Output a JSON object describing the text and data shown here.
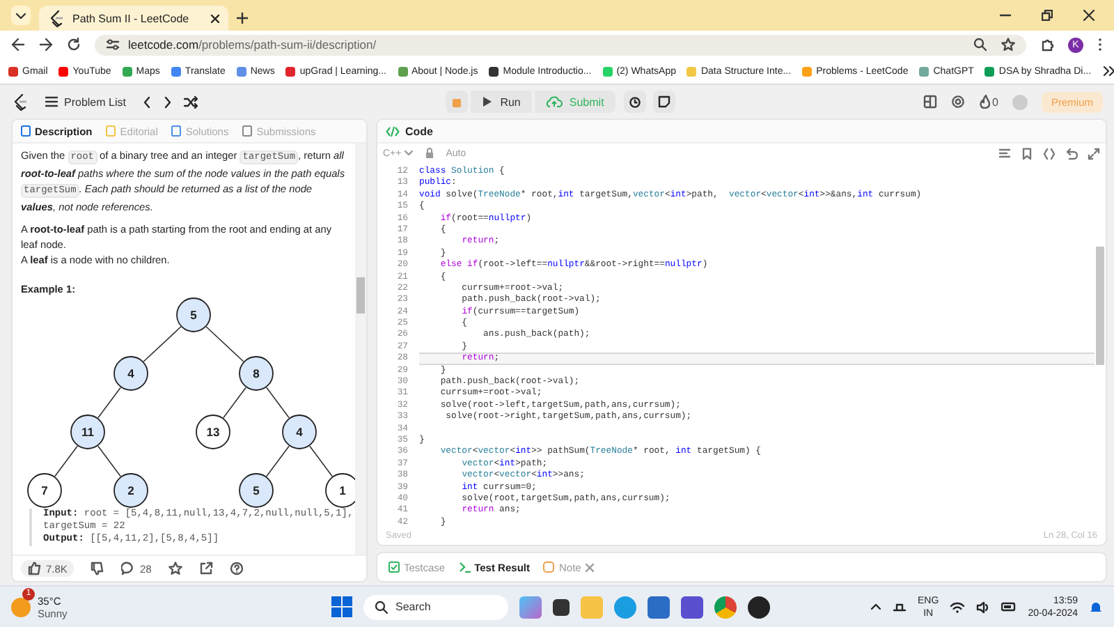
{
  "browser": {
    "tab_title": "Path Sum II - LeetCode",
    "url": {
      "host": "leetcode.com",
      "path": "/problems/path-sum-ii/description/"
    },
    "profile_initial": "K",
    "bookmarks": [
      {
        "label": "Gmail",
        "color": "#d93025"
      },
      {
        "label": "YouTube",
        "color": "#ff0000"
      },
      {
        "label": "Maps",
        "color": "#34a853"
      },
      {
        "label": "Translate",
        "color": "#4285f4"
      },
      {
        "label": "News",
        "color": "#5f8fe8"
      },
      {
        "label": "upGrad | Learning...",
        "color": "#e1262d"
      },
      {
        "label": "About | Node.js",
        "color": "#5fa04e"
      },
      {
        "label": "Module Introductio...",
        "color": "#333333"
      },
      {
        "label": "(2) WhatsApp",
        "color": "#25d366"
      },
      {
        "label": "Data Structure Inte...",
        "color": "#f2c744"
      },
      {
        "label": "Problems - LeetCode",
        "color": "#ffa116"
      },
      {
        "label": "ChatGPT",
        "color": "#74aa9c"
      },
      {
        "label": "DSA by Shradha Di...",
        "color": "#0f9d58"
      }
    ]
  },
  "leetcode_nav": {
    "problem_list": "Problem List",
    "run": "Run",
    "submit": "Submit",
    "streak": "0",
    "premium": "Premium"
  },
  "problem": {
    "tabs": [
      {
        "label": "Description",
        "selected": true
      },
      {
        "label": "Editorial",
        "selected": false
      },
      {
        "label": "Solutions",
        "selected": false
      },
      {
        "label": "Submissions",
        "selected": false
      }
    ],
    "paragraphs": [
      [
        {
          "kind": "text",
          "text": "Given the "
        },
        {
          "kind": "code",
          "text": "root"
        },
        {
          "kind": "text",
          "text": " of a binary tree and an integer "
        },
        {
          "kind": "code",
          "text": "targetSum"
        },
        {
          "kind": "text",
          "text": ", return "
        },
        {
          "kind": "em",
          "text": "all **root-to-leaf** paths where the sum of the node values in the path equals "
        },
        {
          "kind": "code",
          "text": "targetSum"
        },
        {
          "kind": "em",
          "text": ". Each path should be returned as a list of the node **values**, not node references."
        }
      ],
      [
        {
          "kind": "text",
          "text": "A **root-to-leaf** path is a path starting from the root and ending at any leaf node."
        }
      ],
      [
        {
          "kind": "text",
          "text": "A **leaf** is a node with no children."
        }
      ]
    ],
    "example_title": "Example 1:",
    "tree": {
      "value": "5",
      "highlighted": true,
      "left": {
        "value": "4",
        "highlighted": true,
        "left": {
          "value": "11",
          "highlighted": true,
          "left": {
            "value": "7",
            "highlighted": false
          },
          "right": {
            "value": "2",
            "highlighted": true
          }
        }
      },
      "right": {
        "value": "8",
        "highlighted": true,
        "left": {
          "value": "13",
          "highlighted": false
        },
        "right": {
          "value": "4",
          "highlighted": true,
          "left": {
            "value": "5",
            "highlighted": true
          },
          "right": {
            "value": "1",
            "highlighted": false
          }
        }
      }
    },
    "example_lines": [
      {
        "label": "Input:",
        "text": " root = [5,4,8,11,null,13,4,7,2,null,null,5,1],"
      },
      {
        "text": "targetSum = 22"
      },
      {
        "label": "Output:",
        "text": " [[5,4,11,2],[5,8,4,5]]"
      }
    ],
    "likes": "7.8K",
    "comments": "28"
  },
  "editor": {
    "title": "Code",
    "language": "C++",
    "mode": "Auto",
    "lines": [
      {
        "n": "12",
        "code": "class Solution {",
        "current": false
      },
      {
        "n": "13",
        "code": "public:",
        "current": false
      },
      {
        "n": "14",
        "code": "void solve(TreeNode* root,int targetSum,vector<int>path,  vector<vector<int>>&ans,int currsum)",
        "current": false
      },
      {
        "n": "15",
        "code": "{",
        "current": false
      },
      {
        "n": "16",
        "code": "    if(root==nullptr)",
        "current": false
      },
      {
        "n": "17",
        "code": "    {",
        "current": false
      },
      {
        "n": "18",
        "code": "        return;",
        "current": false
      },
      {
        "n": "19",
        "code": "    }",
        "current": false
      },
      {
        "n": "20",
        "code": "    else if(root->left==nullptr&&root->right==nullptr)",
        "current": false
      },
      {
        "n": "21",
        "code": "    {",
        "current": false
      },
      {
        "n": "22",
        "code": "        currsum+=root->val;",
        "current": false
      },
      {
        "n": "23",
        "code": "        path.push_back(root->val);",
        "current": false
      },
      {
        "n": "24",
        "code": "        if(currsum==targetSum)",
        "current": false
      },
      {
        "n": "25",
        "code": "        {",
        "current": false
      },
      {
        "n": "26",
        "code": "            ans.push_back(path);",
        "current": false
      },
      {
        "n": "27",
        "code": "        }",
        "current": false
      },
      {
        "n": "28",
        "code": "        return;",
        "current": true
      },
      {
        "n": "29",
        "code": "    }",
        "current": false
      },
      {
        "n": "30",
        "code": "    path.push_back(root->val);",
        "current": false
      },
      {
        "n": "31",
        "code": "    currsum+=root->val;",
        "current": false
      },
      {
        "n": "32",
        "code": "    solve(root->left,targetSum,path,ans,currsum);",
        "current": false
      },
      {
        "n": "33",
        "code": "     solve(root->right,targetSum,path,ans,currsum);",
        "current": false
      },
      {
        "n": "34",
        "current": false
      },
      {
        "n": "35",
        "code": "}",
        "current": false
      },
      {
        "n": "36",
        "code": "    vector<vector<int>> pathSum(TreeNode* root, int targetSum) {",
        "current": false
      },
      {
        "n": "37",
        "code": "        vector<int>path;",
        "current": false
      },
      {
        "n": "38",
        "code": "        vector<vector<int>>ans;",
        "current": false
      },
      {
        "n": "39",
        "code": "        int currsum=0;",
        "current": false
      },
      {
        "n": "40",
        "code": "        solve(root,targetSum,path,ans,currsum);",
        "current": false
      },
      {
        "n": "41",
        "code": "        return ans;",
        "current": false
      },
      {
        "n": "42",
        "code": "    }",
        "current": false
      }
    ],
    "saved": "Saved",
    "cursor": "Ln 28, Col 16",
    "bottom_tabs": [
      {
        "kind": "testcase",
        "label": "Testcase",
        "selected": false
      },
      {
        "kind": "result",
        "label": "Test Result",
        "selected": true
      },
      {
        "kind": "note",
        "label": "Note",
        "selected": false
      }
    ]
  },
  "taskbar": {
    "temperature": "35°C",
    "weather": "Sunny",
    "badge": "1",
    "search": "Search",
    "language": "ENG",
    "region": "IN",
    "time": "13:59",
    "date": "20-04-2024"
  }
}
